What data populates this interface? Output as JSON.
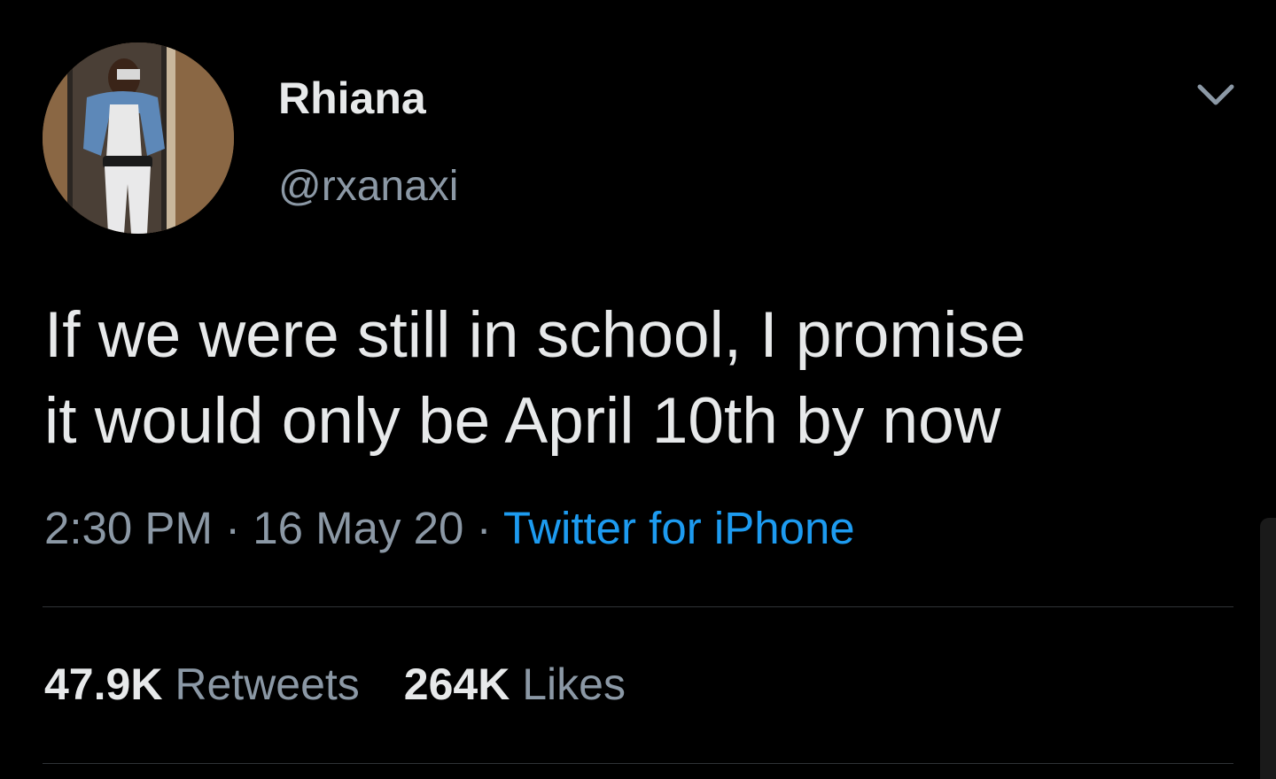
{
  "user": {
    "display_name": "Rhiana",
    "handle": "@rxanaxi"
  },
  "tweet": {
    "lines": [
      "If we were still in school, I promise",
      "it would only be April 10th by now"
    ],
    "time": "2:30 PM",
    "separator": "·",
    "date": "16 May 20",
    "source": "Twitter for iPhone"
  },
  "stats": {
    "retweets_count": "47.9K",
    "retweets_label": "Retweets",
    "likes_count": "264K",
    "likes_label": "Likes"
  },
  "colors": {
    "background": "#000000",
    "text": "#e7e9ea",
    "secondary": "#8b98a5",
    "link": "#1d9bf0",
    "divider": "#2f3336"
  },
  "icons": {
    "more": "chevron-down-icon",
    "avatar": "profile-photo"
  }
}
